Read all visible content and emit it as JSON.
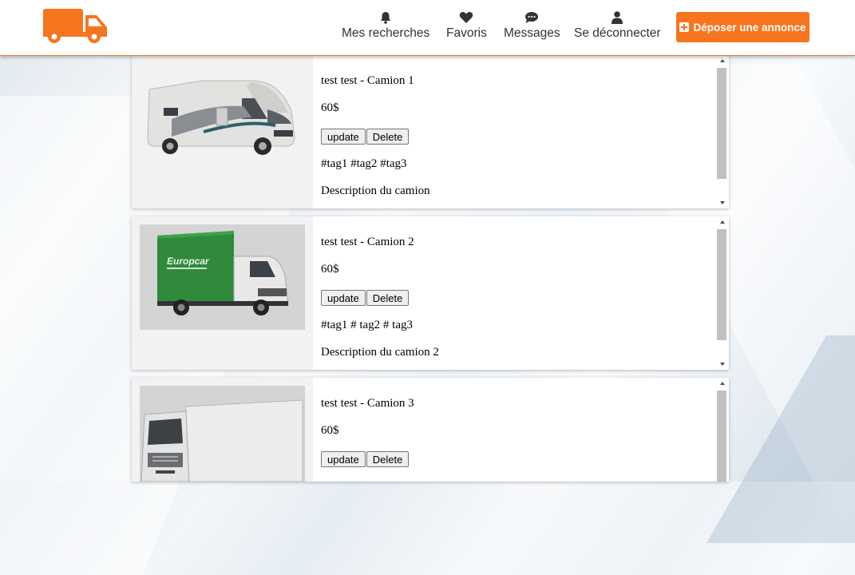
{
  "header": {
    "nav": [
      {
        "label": "Mes recherches",
        "icon": "bell-icon"
      },
      {
        "label": "Favoris",
        "icon": "heart-icon"
      },
      {
        "label": "Messages",
        "icon": "chat-icon"
      },
      {
        "label": "Se déconnecter",
        "icon": "user-icon"
      }
    ],
    "cta_label": "Déposer une annonce",
    "accent_color": "#f7751f"
  },
  "listings": [
    {
      "title": "test test - Camion 1",
      "price": "60$",
      "update_label": "update",
      "delete_label": "Delete",
      "tags": "#tag1 #tag2 #tag3",
      "description": "Description du camion",
      "image": "motorhome"
    },
    {
      "title": "test test - Camion 2",
      "price": "60$",
      "update_label": "update",
      "delete_label": "Delete",
      "tags": "#tag1 # tag2 # tag3",
      "description": "Description du camion 2",
      "image": "europcar-box-truck"
    },
    {
      "title": "test test - Camion 3",
      "price": "60$",
      "update_label": "update",
      "delete_label": "Delete",
      "tags": "",
      "description": "",
      "image": "white-box-truck"
    }
  ]
}
